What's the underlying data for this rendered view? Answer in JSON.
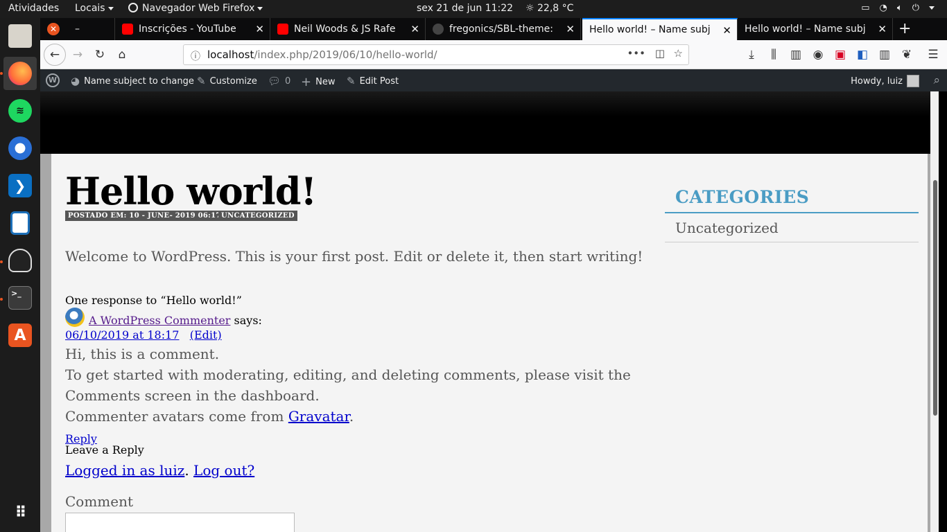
{
  "system": {
    "activities": "Atividades",
    "places": "Locais",
    "app_menu": "Navegador Web Firefox",
    "clock": "sex 21 de jun  11:22",
    "weather": "22,8 °C"
  },
  "dock": {
    "items": [
      "files-app",
      "firefox-app",
      "spotify-app",
      "thunderbird-app",
      "vscode-app",
      "libreoffice-impress-app",
      "inkscape-app",
      "terminal-app",
      "software-center-app",
      "show-applications"
    ]
  },
  "tabs": [
    {
      "label": "–"
    },
    {
      "label": "Inscrições - YouTube"
    },
    {
      "label": "Neil Woods & JS Rafe"
    },
    {
      "label": "fregonics/SBL-theme:"
    },
    {
      "label": "Hello world! – Name subj"
    },
    {
      "label": "Hello world! – Name subj"
    }
  ],
  "navbar": {
    "url_host": "localhost",
    "url_path": "/index.php/2019/06/10/hello-world/"
  },
  "adminbar": {
    "site_name": "Name subject to change",
    "customize": "Customize",
    "comments_count": "0",
    "new": "New",
    "edit_post": "Edit Post",
    "howdy": "Howdy, luiz"
  },
  "post": {
    "title": "Hello world!",
    "posted_on": "POSTADO EM: 10 - JUNE- 2019 06:17",
    "category": "UNCATEGORIZED",
    "body": "Welcome to WordPress. This is your first post. Edit or delete it, then start writing!"
  },
  "comments": {
    "heading": "One response to “Hello world!”",
    "author": "A WordPress Commenter",
    "says": "says:",
    "date": "06/10/2019 at 18:17",
    "edit": "(Edit)",
    "line1": "Hi, this is a comment.",
    "line2": "To get started with moderating, editing, and deleting comments, please visit the",
    "line3": "Comments screen in the dashboard.",
    "line4_prefix": "Commenter avatars come from",
    "line4_link": "Gravatar",
    "line4_suffix": ".",
    "reply": "Reply"
  },
  "reply_form": {
    "heading": "Leave a Reply",
    "logged_in": "Logged in as luiz",
    "sep": ".",
    "logout": "Log out?",
    "comment_label": "Comment"
  },
  "sidebar": {
    "title": "CATEGORIES",
    "items": [
      "Uncategorized"
    ]
  },
  "colors": {
    "accent": "#0a84ff",
    "wp_admin_bar": "#23282d",
    "sidebar_title": "#4a9cc4",
    "ubuntu_orange": "#e95420"
  }
}
